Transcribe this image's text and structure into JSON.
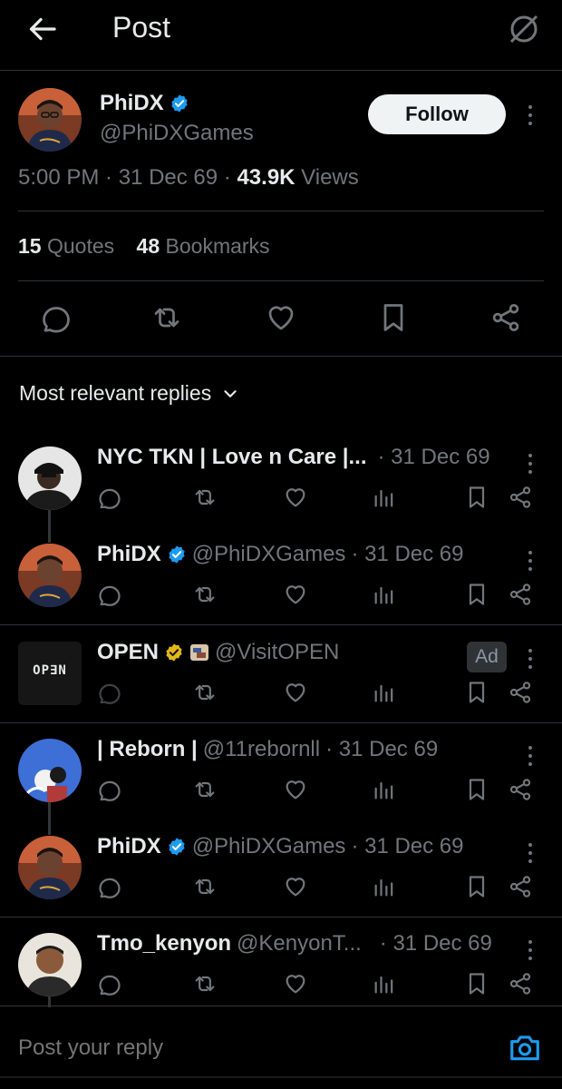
{
  "header": {
    "title": "Post",
    "back_icon": "arrow-left-icon",
    "grok_icon": "grok-icon"
  },
  "post": {
    "author_name": "PhiDX",
    "author_handle": "@PhiDXGames",
    "follow_label": "Follow",
    "time": "5:00 PM",
    "date": "31 Dec 69",
    "views_count": "43.9K",
    "views_label": "Views",
    "quotes_count": "15",
    "quotes_label": "Quotes",
    "bookmarks_count": "48",
    "bookmarks_label": "Bookmarks"
  },
  "sort": {
    "label": "Most relevant replies"
  },
  "replies": [
    {
      "name": "NYC TKN | Love n Care |...",
      "handle": "",
      "date": "· 31 Dec 69"
    },
    {
      "name": "PhiDX",
      "handle": "@PhiDXGames",
      "date": "· 31 Dec 69"
    },
    {
      "name": "OPEN",
      "handle": "@VisitOPEN",
      "date": "",
      "ad": "Ad",
      "avatar_text": "OP∃N"
    },
    {
      "name": "| Reborn |",
      "handle": "@11rebornll",
      "date": "· 31 Dec 69"
    },
    {
      "name": "PhiDX",
      "handle": "@PhiDXGames",
      "date": "· 31 Dec 69"
    },
    {
      "name": "Tmo_kenyon",
      "handle": "@KenyonT...",
      "date": "· 31 Dec 69"
    }
  ],
  "reply_bar": {
    "placeholder": "Post your reply"
  },
  "colors": {
    "background": "#000000",
    "text": "#e7e9ea",
    "muted": "#71767b",
    "accent": "#1d9bf0",
    "gold": "#e2b719",
    "divider": "#2f3336"
  }
}
